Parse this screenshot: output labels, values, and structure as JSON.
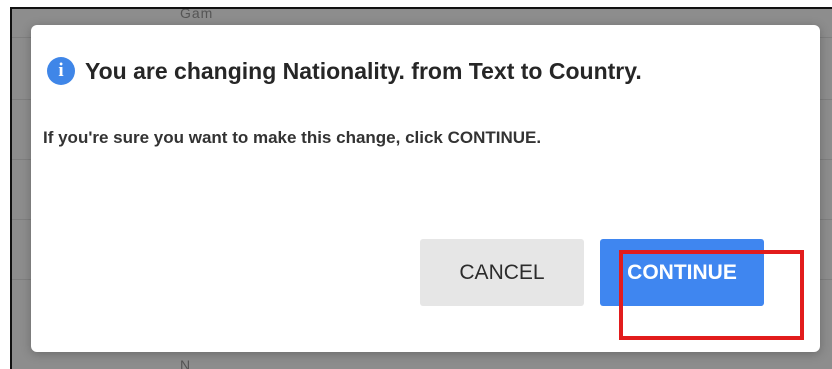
{
  "background": {
    "row_top_text": "Gam",
    "row_bottom_text": "N"
  },
  "dialog": {
    "icon": "info-icon",
    "icon_glyph": "i",
    "title": "You are changing Nationality. from Text to Country.",
    "message": "If you're sure you want to make this change, click CONTINUE.",
    "buttons": {
      "cancel_label": "CANCEL",
      "continue_label": "CONTINUE"
    }
  },
  "colors": {
    "accent": "#3f86f0",
    "highlight": "#e21c1c",
    "cancel_bg": "#e6e6e6"
  }
}
